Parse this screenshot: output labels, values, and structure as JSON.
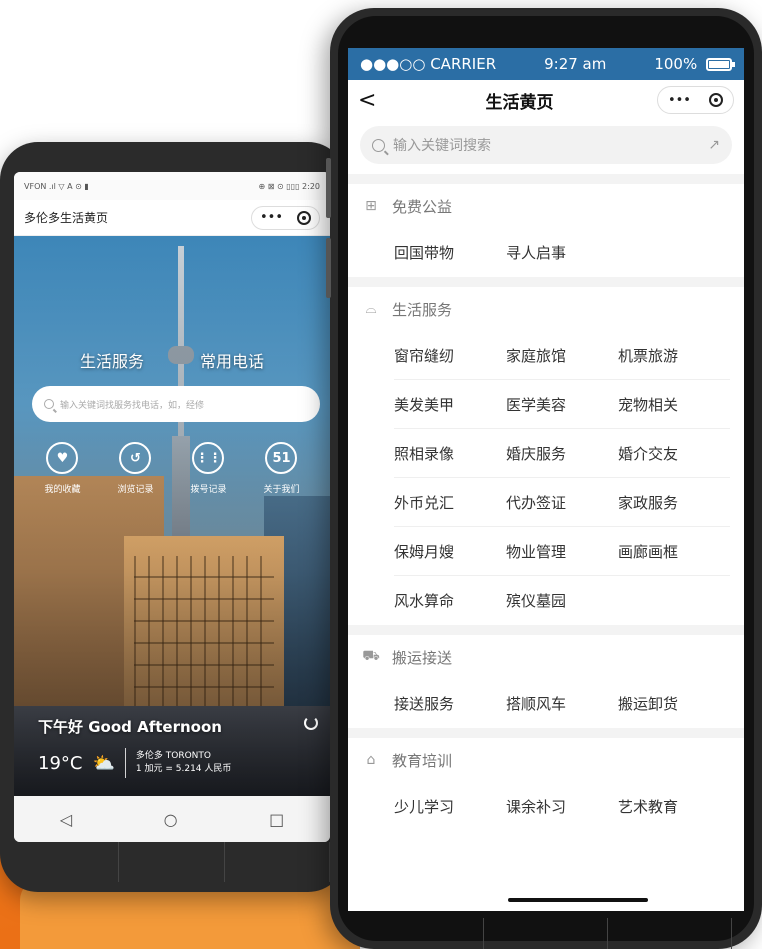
{
  "left_phone": {
    "status_bar": {
      "left": "VFON .ıl ▽ A ⊙ ▮",
      "right": "⊕ ⊠ ⊙ ▯▯▯ 2:20"
    },
    "nav": {
      "title": "多伦多生活黄页",
      "more_label": "•••"
    },
    "hero": {
      "tabs": [
        "生活服务",
        "常用电话"
      ],
      "search_placeholder": "输入关键词找服务找电话，如，经修",
      "quick_links": [
        {
          "label": "我的收藏",
          "icon": "heart-icon",
          "glyph": "♥"
        },
        {
          "label": "浏览记录",
          "icon": "history-icon",
          "glyph": "↺"
        },
        {
          "label": "拨号记录",
          "icon": "dialpad-icon",
          "glyph": "⋮⋮"
        },
        {
          "label": "关于我们",
          "icon": "logo-icon",
          "glyph": "51"
        }
      ],
      "greeting": "下午好 Good Afternoon",
      "temperature": "19°C",
      "city": "多伦多 TORONTO",
      "exchange_rate": "1 加元 = 5.214 人民币"
    },
    "android_nav": [
      "◁",
      "○",
      "□"
    ]
  },
  "right_phone": {
    "status_bar": {
      "carrier": "●●●○○ CARRIER",
      "time": "9:27 am",
      "battery": "100%"
    },
    "nav": {
      "back_glyph": "<",
      "title": "生活黄页",
      "more_label": "•••"
    },
    "search": {
      "placeholder": "输入关键词搜索"
    },
    "sections": [
      {
        "title": "免费公益",
        "icon": "grid-icon",
        "glyph": "⊞",
        "items": [
          "回国带物",
          "寻人启事"
        ]
      },
      {
        "title": "生活服务",
        "icon": "basket-icon",
        "glyph": "⌓",
        "items": [
          "窗帘缝纫",
          "家庭旅馆",
          "机票旅游",
          "美发美甲",
          "医学美容",
          "宠物相关",
          "照相录像",
          "婚庆服务",
          "婚介交友",
          "外币兑汇",
          "代办签证",
          "家政服务",
          "保姆月嫂",
          "物业管理",
          "画廊画框",
          "风水算命",
          "殡仪墓园"
        ]
      },
      {
        "title": "搬运接送",
        "icon": "truck-icon",
        "glyph": "⛟",
        "items": [
          "接送服务",
          "搭顺风车",
          "搬运卸货"
        ]
      },
      {
        "title": "教育培训",
        "icon": "book-icon",
        "glyph": "⌂",
        "items": [
          "少儿学习",
          "课余补习",
          "艺术教育"
        ]
      }
    ]
  },
  "colors": {
    "status_blue": "#2b6ea5",
    "orange": "#ef7d1f"
  }
}
